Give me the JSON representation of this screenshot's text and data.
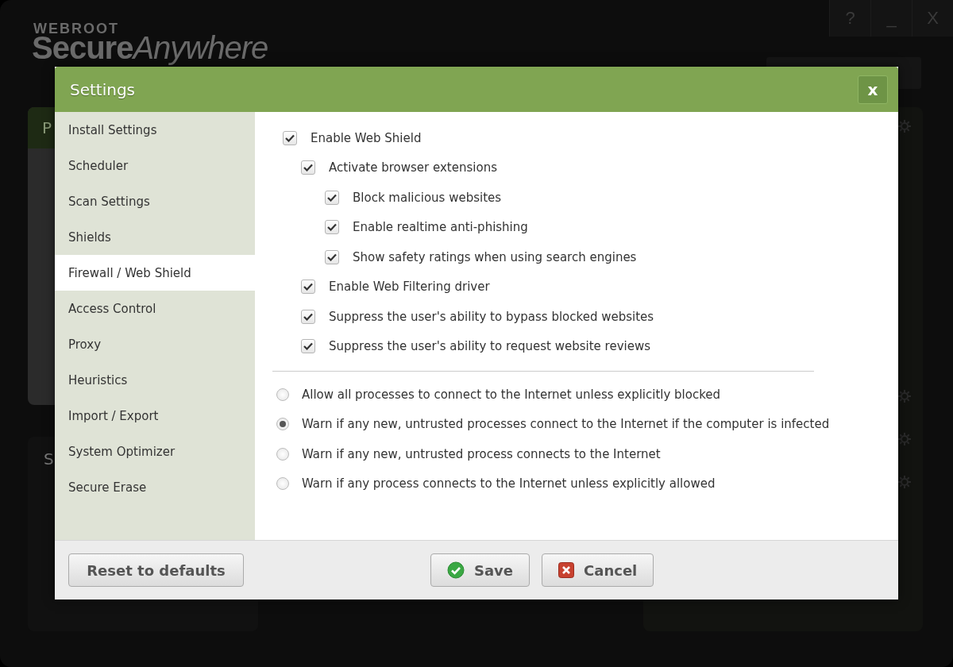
{
  "app": {
    "brand": "WEBROOT",
    "product": "**Secure**Anywhere",
    "window_buttons": [
      "?",
      "_",
      "X"
    ],
    "panel_1": {
      "title": "P"
    },
    "panel_2": {
      "title": "S"
    }
  },
  "dialog": {
    "title": "Settings",
    "close": "x"
  },
  "sidebar": {
    "items": [
      {
        "label": "Install Settings",
        "selected": false
      },
      {
        "label": "Scheduler",
        "selected": false
      },
      {
        "label": "Scan Settings",
        "selected": false
      },
      {
        "label": "Shields",
        "selected": false
      },
      {
        "label": "Firewall / Web Shield",
        "selected": true
      },
      {
        "label": "Access Control",
        "selected": false
      },
      {
        "label": "Proxy",
        "selected": false
      },
      {
        "label": "Heuristics",
        "selected": false
      },
      {
        "label": "Import / Export",
        "selected": false
      },
      {
        "label": "System Optimizer",
        "selected": false
      },
      {
        "label": "Secure Erase",
        "selected": false
      }
    ]
  },
  "options": [
    {
      "label": "Enable Web Shield",
      "checked": true,
      "children": [
        {
          "label": "Activate browser extensions",
          "checked": true,
          "children": [
            {
              "label": "Block malicious websites",
              "checked": true
            },
            {
              "label": "Enable realtime anti-phishing",
              "checked": true
            },
            {
              "label": "Show safety ratings when using search engines",
              "checked": true
            }
          ]
        },
        {
          "label": "Enable Web Filtering driver",
          "checked": true
        },
        {
          "label": "Suppress the user's ability to bypass blocked websites",
          "checked": true
        },
        {
          "label": "Suppress the user's ability to request website reviews",
          "checked": true
        }
      ]
    }
  ],
  "firewall": [
    {
      "label": "Allow all processes to connect to the Internet unless explicitly blocked",
      "selected": false
    },
    {
      "label": "Warn if any new, untrusted processes connect to the Internet if the computer is infected",
      "selected": true
    },
    {
      "label": "Warn if any new, untrusted process connects to the Internet",
      "selected": false
    },
    {
      "label": "Warn if any process connects to the Internet unless explicitly allowed",
      "selected": false
    }
  ],
  "footer": {
    "reset": "Reset to defaults",
    "save": "Save",
    "cancel": "Cancel"
  }
}
